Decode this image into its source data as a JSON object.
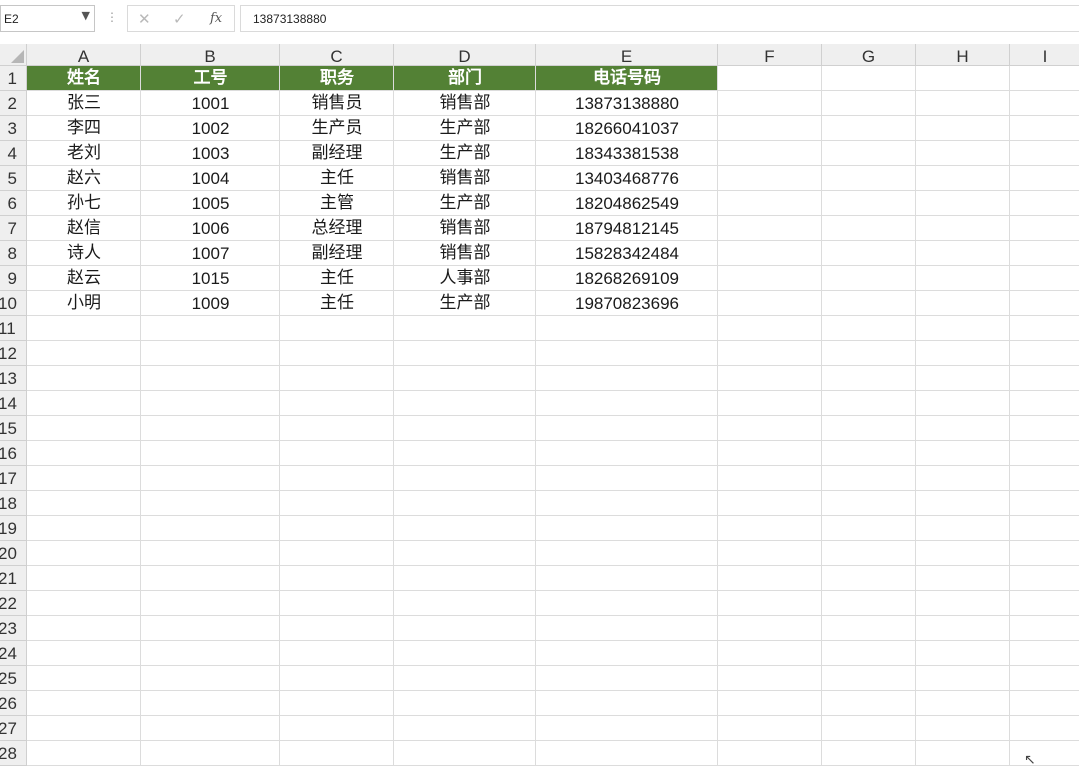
{
  "formula_bar": {
    "name_box": "E2",
    "name_box_caret": "▼",
    "cancel_glyph": "✕",
    "enter_glyph": "✓",
    "fx_label": "fx",
    "formula_value": "13873138880"
  },
  "sheet": {
    "column_headers": [
      "A",
      "B",
      "C",
      "D",
      "E",
      "F",
      "G",
      "H",
      "I"
    ],
    "row_numbers": [
      "1",
      "2",
      "3",
      "4",
      "5",
      "6",
      "7",
      "8",
      "9",
      "10",
      "11",
      "12",
      "13",
      "14",
      "15",
      "16",
      "17",
      "18",
      "19",
      "20",
      "21",
      "22",
      "23",
      "24",
      "25",
      "26",
      "27",
      "28"
    ],
    "header_row": [
      "姓名",
      "工号",
      "职务",
      "部门",
      "电话号码"
    ],
    "rows": [
      [
        "张三",
        "1001",
        "销售员",
        "销售部",
        "13873138880"
      ],
      [
        "李四",
        "1002",
        "生产员",
        "生产部",
        "18266041037"
      ],
      [
        "老刘",
        "1003",
        "副经理",
        "生产部",
        "18343381538"
      ],
      [
        "赵六",
        "1004",
        "主任",
        "销售部",
        "13403468776"
      ],
      [
        "孙七",
        "1005",
        "主管",
        "生产部",
        "18204862549"
      ],
      [
        "赵信",
        "1006",
        "总经理",
        "销售部",
        "18794812145"
      ],
      [
        "诗人",
        "1007",
        "副经理",
        "销售部",
        "15828342484"
      ],
      [
        "赵云",
        "1015",
        "主任",
        "人事部",
        "18268269109"
      ],
      [
        "小明",
        "1009",
        "主任",
        "生产部",
        "19870823696"
      ]
    ],
    "header_fill_color": "#538135",
    "header_text_color": "#ffffff"
  },
  "icons": {
    "select_all": "select-all-triangle",
    "cursor": "mouse-pointer-icon"
  }
}
